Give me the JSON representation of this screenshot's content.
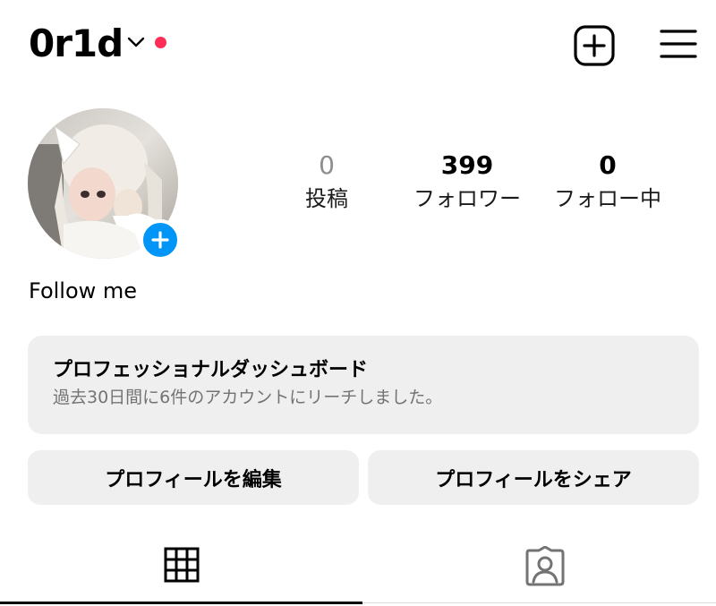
{
  "header": {
    "username": "0r1d",
    "dropdown_icon": "chevron-down-icon",
    "notification_color": "#ff2d55",
    "create_icon": "plus-square-icon",
    "menu_icon": "hamburger-menu-icon"
  },
  "profile": {
    "avatar_icon": "avatar-photo",
    "add_story_icon": "plus-icon",
    "bio": "Follow me"
  },
  "stats": [
    {
      "value": "0",
      "label": "投稿"
    },
    {
      "value": "399",
      "label": "フォロワー"
    },
    {
      "value": "0",
      "label": "フォロー中"
    }
  ],
  "dashboard": {
    "title": "プロフェッショナルダッシュボード",
    "subtitle": "過去30日間に6件のアカウントにリーチしました。"
  },
  "buttons": {
    "edit_profile": "プロフィールを編集",
    "share_profile": "プロフィールをシェア"
  },
  "tabs": [
    {
      "icon": "grid-icon",
      "active": true
    },
    {
      "icon": "tagged-person-icon",
      "active": false
    }
  ],
  "colors": {
    "accent_blue": "#0095f6",
    "button_bg": "#efefef",
    "muted_text": "#8e8e8e"
  }
}
